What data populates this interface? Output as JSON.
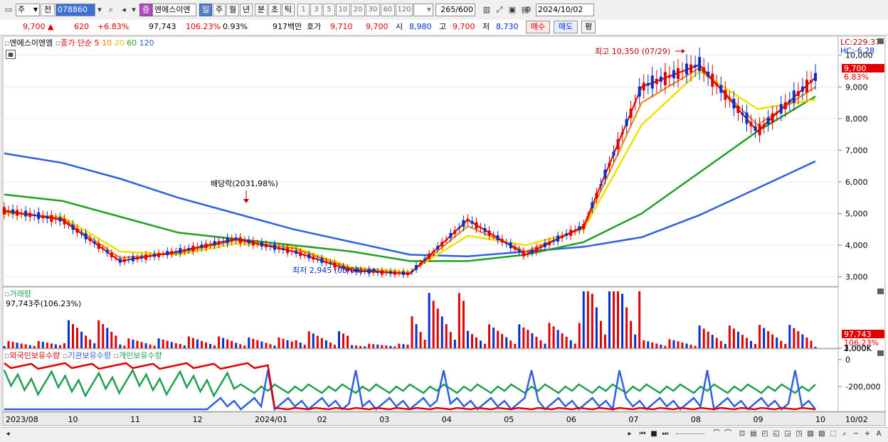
{
  "toolbar": {
    "period_select": "주",
    "prev_label": "전",
    "code": "078860",
    "name_badge": "증",
    "stock_name": "엔에스이엔",
    "timeframes": [
      "일",
      "주",
      "월",
      "년",
      "분",
      "초",
      "틱"
    ],
    "active_timeframe": "일",
    "intervals": [
      "1",
      "3",
      "5",
      "10",
      "20",
      "30",
      "60",
      "120"
    ],
    "count": "265",
    "count_total": "/600",
    "date": "2024/10/02"
  },
  "quote": {
    "price": "9,700",
    "change": "620",
    "change_pct": "+6.83%",
    "volume": "97,743",
    "volume_pct": "106.23%",
    "turnover_pct": "0.93%",
    "amount": "917백만",
    "bid_label": "호가",
    "bid1": "9,710",
    "bid2": "9,700",
    "open_label": "시",
    "open": "8,980",
    "high_label": "고",
    "high": "9,700",
    "low_label": "저",
    "low": "8,730",
    "buy_label": "매수",
    "sell_label": "매도",
    "eval_label": "평"
  },
  "legend": {
    "name": "엔에스이엔엠",
    "ma_label": "종가 단순",
    "ma_periods": [
      "5",
      "10",
      "20",
      "60",
      "120"
    ],
    "volume_title": "거래량",
    "volume_value": "97,743주(106.23%)",
    "holdings": [
      "외국인보유수량",
      "기관보유수량",
      "개인보유수량"
    ]
  },
  "annotations": {
    "high_label": "최고 10,350 (07/29)",
    "low_label": "최저 2,945 (03/04)",
    "dividend_label": "배당락(2031,98%)",
    "lc": "LC:229.37",
    "hc": "HC:-6.28",
    "price_tag": "9,700",
    "pct_tag": "6.83%",
    "vol_tag": "97,743",
    "vol_pct_tag": "106.23%"
  },
  "axes": {
    "price_ticks": [
      "10,000",
      "9,000",
      "8,000",
      "7,000",
      "6,000",
      "5,000",
      "4,000",
      "3,000"
    ],
    "volume_ticks": [
      "3,000K",
      "2,000K",
      "1,000K"
    ],
    "holding_ticks": [
      "0",
      "-200,000"
    ],
    "date_labels": [
      "2023/08",
      "10",
      "11",
      "12",
      "2024/01",
      "02",
      "03",
      "04",
      "05",
      "06",
      "07",
      "08",
      "09",
      "10",
      "10/02"
    ]
  },
  "colors": {
    "up": "#e00000",
    "down": "#0030d0",
    "ma5": "#e00000",
    "ma10": "#f08000",
    "ma20": "#f0e000",
    "ma60": "#20a020",
    "ma120": "#3060e0",
    "foreign": "#e00000",
    "institution": "#3060e0",
    "individual": "#20a050"
  },
  "chart_data": {
    "type": "line",
    "title": "엔에스이엔엠",
    "y_range": [
      2700,
      10600
    ],
    "series": [
      {
        "name": "5",
        "x": [
          "2023/08",
          "2023/09",
          "2023/10",
          "2023/11",
          "2023/12",
          "2024/01",
          "2024/02",
          "2024/03",
          "2024/04",
          "2024/05",
          "2024/06",
          "2024/07",
          "2024/08",
          "2024/09",
          "2024/10"
        ],
        "values": [
          5100,
          4800,
          3500,
          3800,
          4200,
          3800,
          3200,
          3100,
          4800,
          3700,
          4600,
          9000,
          9700,
          7600,
          9300
        ]
      },
      {
        "name": "10",
        "x": [
          "2023/08",
          "2023/09",
          "2023/10",
          "2023/11",
          "2023/12",
          "2024/01",
          "2024/02",
          "2024/03",
          "2024/04",
          "2024/05",
          "2024/06",
          "2024/07",
          "2024/08",
          "2024/09",
          "2024/10"
        ],
        "values": [
          5050,
          4850,
          3600,
          3750,
          4150,
          3900,
          3250,
          3100,
          4600,
          3800,
          4550,
          8500,
          9600,
          7800,
          9000
        ]
      },
      {
        "name": "20",
        "x": [
          "2023/08",
          "2023/09",
          "2023/10",
          "2023/11",
          "2023/12",
          "2024/01",
          "2024/02",
          "2024/03",
          "2024/04",
          "2024/05",
          "2024/06",
          "2024/07",
          "2024/08",
          "2024/09",
          "2024/10"
        ],
        "values": [
          5000,
          4900,
          3800,
          3700,
          4050,
          3950,
          3300,
          3150,
          4300,
          4000,
          4500,
          7800,
          9500,
          8300,
          8600
        ]
      },
      {
        "name": "60",
        "x": [
          "2023/08",
          "2023/09",
          "2023/10",
          "2023/11",
          "2023/12",
          "2024/01",
          "2024/02",
          "2024/03",
          "2024/04",
          "2024/05",
          "2024/06",
          "2024/07",
          "2024/08",
          "2024/09",
          "2024/10"
        ],
        "values": [
          5600,
          5400,
          4900,
          4400,
          4200,
          4000,
          3800,
          3500,
          3500,
          3700,
          4100,
          5000,
          6300,
          7600,
          8700
        ]
      },
      {
        "name": "120",
        "x": [
          "2023/08",
          "2023/09",
          "2023/10",
          "2023/11",
          "2023/12",
          "2024/01",
          "2024/02",
          "2024/03",
          "2024/04",
          "2024/05",
          "2024/06",
          "2024/07",
          "2024/08",
          "2024/09",
          "2024/10"
        ],
        "values": [
          6900,
          6600,
          6100,
          5500,
          5000,
          4500,
          4100,
          3700,
          3650,
          3800,
          3950,
          4250,
          4950,
          5800,
          6650
        ]
      }
    ]
  }
}
